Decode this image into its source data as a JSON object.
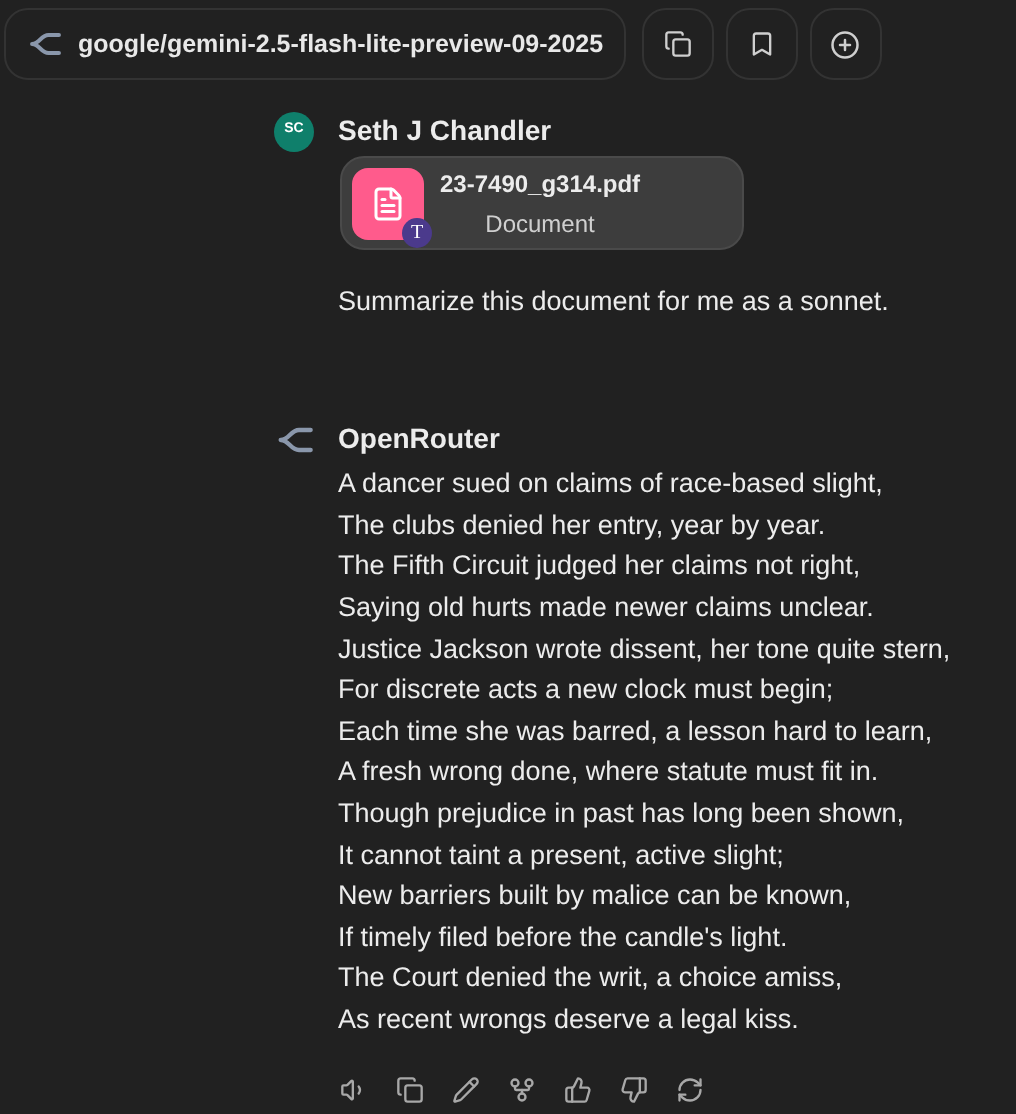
{
  "header": {
    "model": "google/gemini-2.5-flash-lite-preview-09-2025"
  },
  "user_message": {
    "avatar": "SC",
    "author": "Seth J Chandler",
    "attachment": {
      "filename": "23-7490_g314.pdf",
      "type": "Document",
      "badge": "T"
    },
    "text": "Summarize this document for me as a sonnet."
  },
  "assistant_message": {
    "author": "OpenRouter",
    "lines": [
      "A dancer sued on claims of race-based slight,",
      "The clubs denied her entry, year by year.",
      "The Fifth Circuit judged her claims not right,",
      "Saying old hurts made newer claims unclear.",
      "Justice Jackson wrote dissent, her tone quite stern,",
      "For discrete acts a new clock must begin;",
      "Each time she was barred, a lesson hard to learn,",
      "A fresh wrong done, where statute must fit in.",
      "Though prejudice in past has long been shown,",
      "It cannot taint a present, active slight;",
      "New barriers built by malice can be known,",
      "If timely filed before the candle's light.",
      "The Court denied the writ, a choice amiss,",
      "As recent wrongs deserve a legal kiss."
    ]
  },
  "actions": [
    {
      "kind": "read-aloud"
    },
    {
      "kind": "copy"
    },
    {
      "kind": "edit"
    },
    {
      "kind": "branch"
    },
    {
      "kind": "like"
    },
    {
      "kind": "dislike"
    },
    {
      "kind": "regenerate"
    }
  ]
}
